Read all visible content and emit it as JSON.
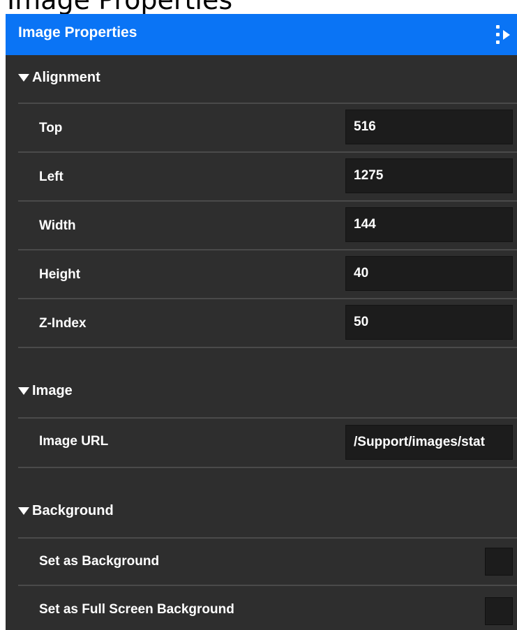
{
  "top_strip_text": "Image Properties",
  "panel": {
    "title": "Image Properties",
    "menu_icon": "more-arrow-icon"
  },
  "sections": {
    "alignment": {
      "title": "Alignment",
      "rows": [
        {
          "label": "Top",
          "value": "516"
        },
        {
          "label": "Left",
          "value": "1275"
        },
        {
          "label": "Width",
          "value": "144"
        },
        {
          "label": "Height",
          "value": "40"
        },
        {
          "label": "Z-Index",
          "value": "50"
        }
      ]
    },
    "image": {
      "title": "Image",
      "rows": [
        {
          "label": "Image URL",
          "value": "/Support/images/stat"
        }
      ]
    },
    "background": {
      "title": "Background",
      "rows": [
        {
          "label": "Set as Background",
          "checked": false
        },
        {
          "label": "Set as Full Screen Background",
          "checked": false
        }
      ]
    }
  },
  "colors": {
    "header": "#0a74f5",
    "panel_bg": "#2e2e2e",
    "field_bg": "#1c1c1c",
    "divider": "#4a4a4a"
  }
}
